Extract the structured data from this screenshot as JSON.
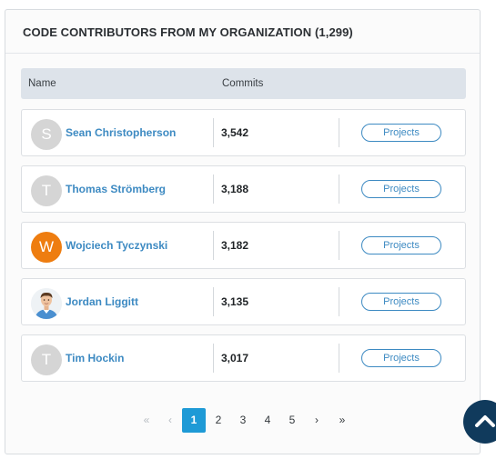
{
  "panel": {
    "title": "CODE CONTRIBUTORS FROM MY ORGANIZATION",
    "count": "(1,299)"
  },
  "table": {
    "headers": {
      "name": "Name",
      "commits": "Commits"
    },
    "rows": [
      {
        "initial": "S",
        "avatar": "initial-gray",
        "name": "Sean Christopherson",
        "commits": "3,542",
        "action": "Projects"
      },
      {
        "initial": "T",
        "avatar": "initial-gray",
        "name": "Thomas Strömberg",
        "commits": "3,188",
        "action": "Projects"
      },
      {
        "initial": "W",
        "avatar": "initial-orange",
        "name": "Wojciech Tyczynski",
        "commits": "3,182",
        "action": "Projects"
      },
      {
        "initial": "",
        "avatar": "photo",
        "name": "Jordan Liggitt",
        "commits": "3,135",
        "action": "Projects"
      },
      {
        "initial": "T",
        "avatar": "initial-gray",
        "name": "Tim Hockin",
        "commits": "3,017",
        "action": "Projects"
      }
    ]
  },
  "pagination": {
    "first": "«",
    "prev": "‹",
    "pages": [
      "1",
      "2",
      "3",
      "4",
      "5"
    ],
    "current": "1",
    "next": "›",
    "last": "»"
  },
  "colors": {
    "link": "#3d8ac2",
    "active_page": "#1e9ad6",
    "avatar_orange": "#ee7d10",
    "scroll_button": "#103a5c"
  },
  "icons": {
    "scroll_top": "chevron-up-icon"
  }
}
